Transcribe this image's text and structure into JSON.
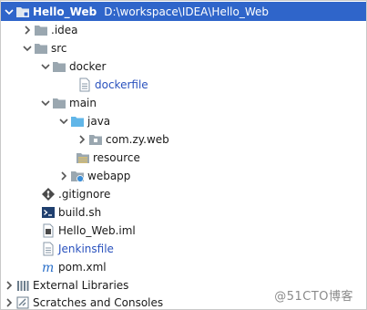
{
  "project": {
    "name": "Hello_Web",
    "path": "D:\\workspace\\IDEA\\Hello_Web"
  },
  "tree": {
    "idea": ".idea",
    "src": "src",
    "docker": "docker",
    "dockerfile": "dockerfile",
    "main": "main",
    "java": "java",
    "package": "com.zy.web",
    "resource": "resource",
    "webapp": "webapp",
    "gitignore": ".gitignore",
    "build": "build.sh",
    "iml": "Hello_Web.iml",
    "jenkinsfile": "Jenkinsfile",
    "pom": "pom.xml",
    "external": "External Libraries",
    "scratches": "Scratches and Consoles"
  },
  "watermark": "@51CTO博客",
  "colors": {
    "selection": "#2f65ca",
    "folder": "#9aa7b0",
    "source_folder": "#61b6e8",
    "link_blue": "#2a52be"
  },
  "icons": {
    "project": "module-folder-icon",
    "folder": "folder-icon",
    "source": "source-folder-icon",
    "package": "package-icon",
    "resource": "resource-folder-icon",
    "web": "web-folder-icon",
    "file": "file-icon",
    "git": "git-icon",
    "shell": "shell-icon",
    "maven": "maven-icon",
    "libraries": "libraries-icon",
    "scratches": "scratches-icon"
  }
}
